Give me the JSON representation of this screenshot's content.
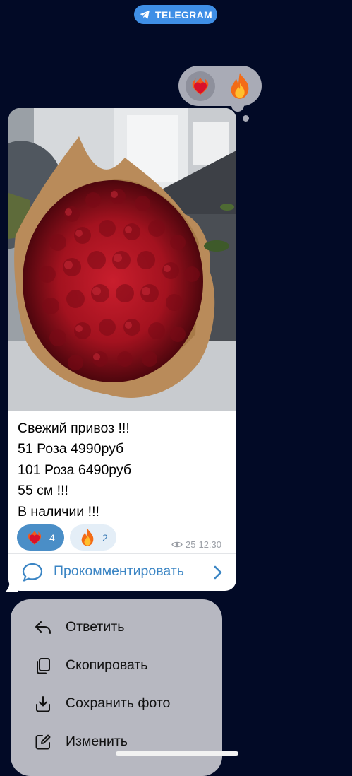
{
  "app": {
    "badge_label": "TELEGRAM"
  },
  "reaction_picker": {
    "options": [
      "heart-on-fire",
      "fire"
    ]
  },
  "post": {
    "caption_lines": [
      "Свежий привоз !!!",
      "51 Роза 4990руб",
      "101 Роза 6490руб",
      "55 см !!!",
      "В наличии !!!"
    ],
    "reactions": [
      {
        "emoji": "heart-on-fire",
        "count": "4",
        "selected": true
      },
      {
        "emoji": "fire",
        "count": "2",
        "selected": false
      }
    ],
    "views": "25",
    "time": "12:30",
    "comment_label": "Прокомментировать"
  },
  "context_menu": {
    "items": [
      {
        "label": "Ответить",
        "icon": "reply-icon"
      },
      {
        "label": "Скопировать",
        "icon": "copy-icon"
      },
      {
        "label": "Сохранить фото",
        "icon": "download-icon"
      },
      {
        "label": "Изменить",
        "icon": "edit-icon"
      }
    ]
  },
  "colors": {
    "background": "#020a26",
    "accent": "#3f8fe6",
    "link": "#3b85c4",
    "menu_bg": "#b7b8c1",
    "bubble": "#ffffff"
  }
}
